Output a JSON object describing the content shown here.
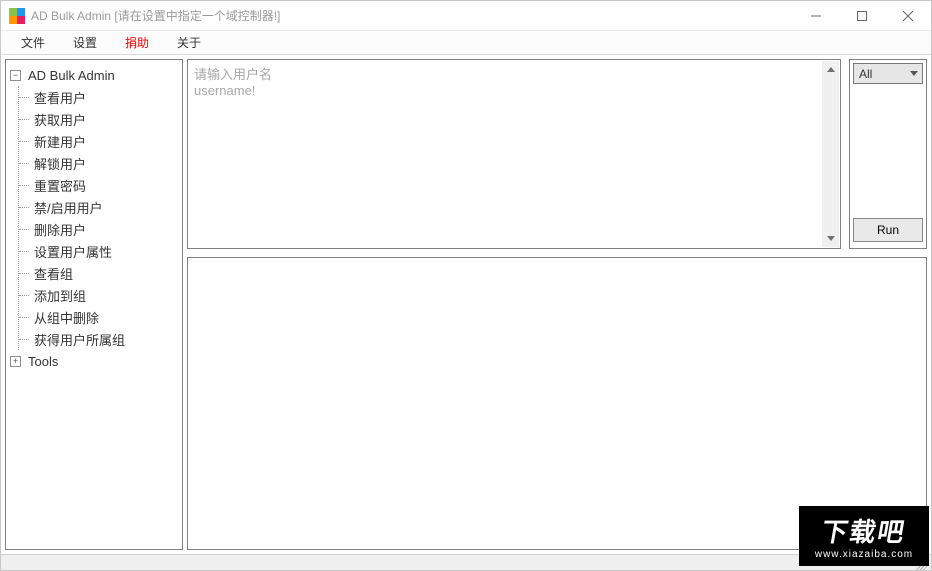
{
  "window": {
    "title": "AD Bulk Admin [请在设置中指定一个域控制器!]"
  },
  "menu": {
    "file": "文件",
    "settings": "设置",
    "donate": "捐助",
    "about": "关于"
  },
  "tree": {
    "root": "AD Bulk Admin",
    "items": [
      "查看用户",
      "获取用户",
      "新建用户",
      "解锁用户",
      "重置密码",
      "禁/启用用户",
      "删除用户",
      "设置用户属性",
      "查看组",
      "添加到组",
      "从组中删除",
      "获得用户所属组"
    ],
    "tools": "Tools"
  },
  "input": {
    "placeholder": "请输入用户名\nusername!"
  },
  "filter": {
    "selected": "All"
  },
  "buttons": {
    "run": "Run"
  },
  "watermark": {
    "big": "下载吧",
    "small": "www.xiazaiba.com"
  }
}
